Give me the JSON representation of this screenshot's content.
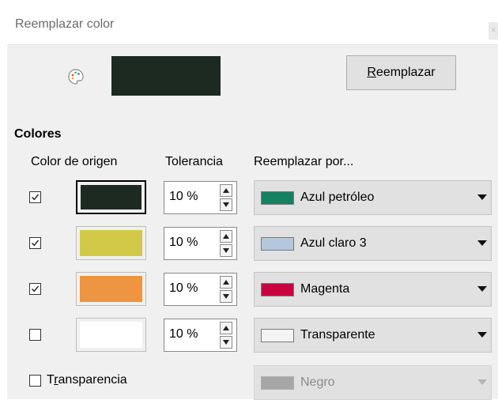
{
  "dialog": {
    "title": "Reemplazar color",
    "pipette_icon": "pipette-palette-icon",
    "source_color": "#1d2a22",
    "replace_button": {
      "label_prefix": "",
      "mnemonic": "R",
      "label_rest": "eemplazar"
    }
  },
  "colors_section": {
    "label": "Colores",
    "headers": {
      "source": "Color de origen",
      "tolerance": "Tolerancia",
      "replace_with": "Reemplazar por..."
    },
    "rows": [
      {
        "checked": true,
        "source_color": "#1d2a22",
        "selected": true,
        "tolerance": "10 %",
        "replace_name": "Azul petróleo",
        "replace_color": "#168062"
      },
      {
        "checked": true,
        "source_color": "#d3c948",
        "selected": false,
        "tolerance": "10 %",
        "replace_name": "Azul claro 3",
        "replace_color": "#b4c7dc"
      },
      {
        "checked": true,
        "source_color": "#ed9540",
        "selected": false,
        "tolerance": "10 %",
        "replace_name": "Magenta",
        "replace_color": "#c9003f"
      },
      {
        "checked": false,
        "source_color": "#ffffff",
        "selected": false,
        "tolerance": "10 %",
        "replace_name": "Transparente",
        "replace_color": "#f4f4f4"
      }
    ]
  },
  "transparency": {
    "checked": false,
    "label_prefix": "T",
    "mnemonic": "r",
    "label_rest": "ansparencia",
    "replace_name": "Negro",
    "replace_color": "#a6a6a6",
    "enabled": false
  }
}
